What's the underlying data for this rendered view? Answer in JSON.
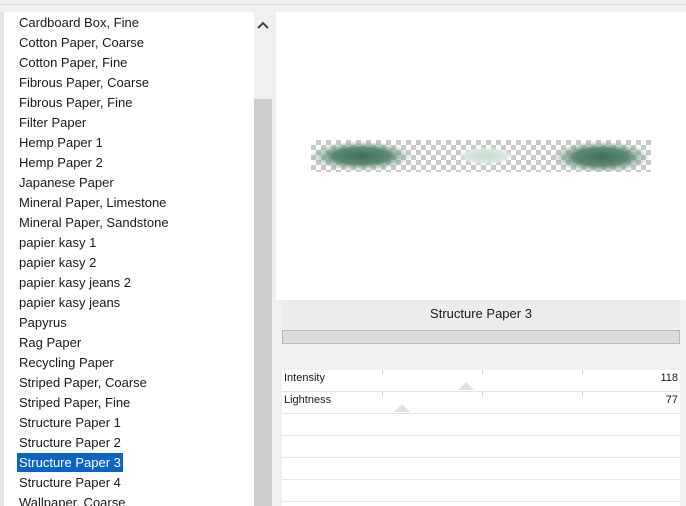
{
  "list": {
    "items": [
      {
        "label": "Cardboard Box, Fine"
      },
      {
        "label": "Cotton Paper, Coarse"
      },
      {
        "label": "Cotton Paper, Fine"
      },
      {
        "label": "Fibrous Paper, Coarse"
      },
      {
        "label": "Fibrous Paper, Fine"
      },
      {
        "label": "Filter Paper"
      },
      {
        "label": "Hemp Paper 1"
      },
      {
        "label": "Hemp Paper 2"
      },
      {
        "label": "Japanese Paper"
      },
      {
        "label": "Mineral Paper, Limestone"
      },
      {
        "label": "Mineral Paper, Sandstone"
      },
      {
        "label": "papier kasy 1"
      },
      {
        "label": "papier kasy 2"
      },
      {
        "label": "papier kasy jeans 2"
      },
      {
        "label": "papier kasy jeans"
      },
      {
        "label": "Papyrus"
      },
      {
        "label": "Rag Paper"
      },
      {
        "label": "Recycling Paper"
      },
      {
        "label": "Striped Paper, Coarse"
      },
      {
        "label": "Striped Paper, Fine"
      },
      {
        "label": "Structure Paper 1"
      },
      {
        "label": "Structure Paper 2"
      },
      {
        "label": "Structure Paper 3",
        "selected": true
      },
      {
        "label": "Structure Paper 4"
      },
      {
        "label": "Wallpaper, Coarse"
      }
    ]
  },
  "icons": {
    "scroll_up": "chevron-up-icon"
  },
  "filter": {
    "name": "Structure Paper 3",
    "params": [
      {
        "label": "Intensity",
        "value": "118"
      },
      {
        "label": "Lightness",
        "value": "77"
      }
    ]
  },
  "colors": {
    "selection": "#0a64c8",
    "texture_green": "#5d8a73"
  }
}
